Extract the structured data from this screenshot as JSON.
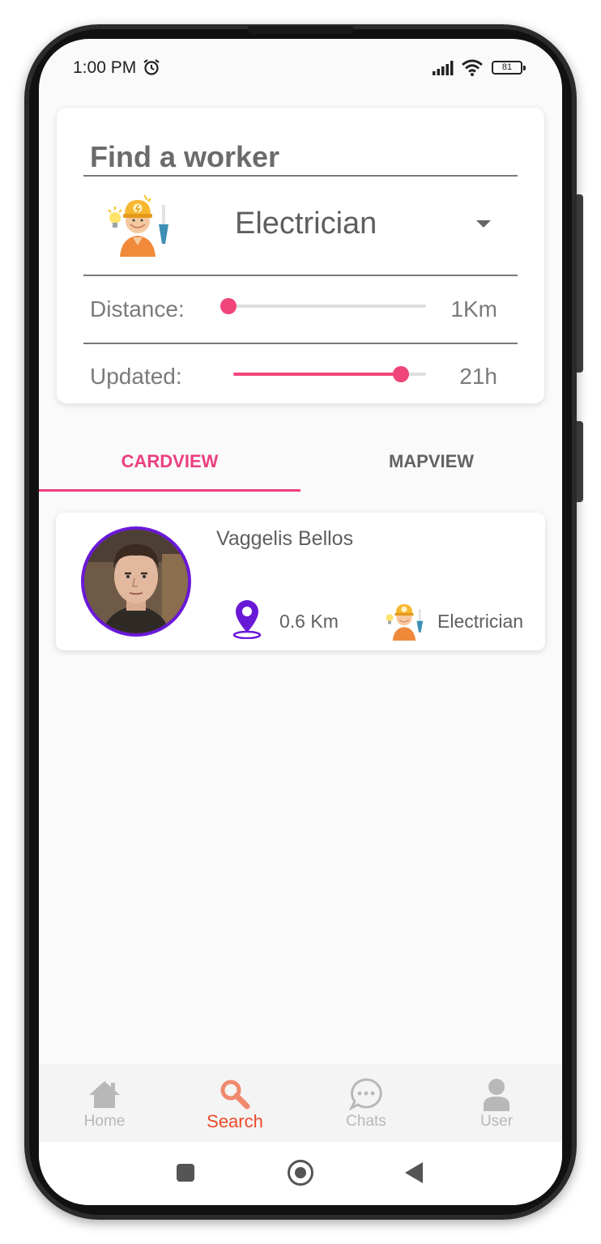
{
  "status_bar": {
    "time": "1:00 PM",
    "battery": "81",
    "icons": [
      "alarm-icon",
      "signal-icon",
      "wifi-icon",
      "battery-icon"
    ]
  },
  "search": {
    "title": "Find a worker",
    "category": "Electrician",
    "distance_label": "Distance:",
    "distance_value": "1Km",
    "distance_fraction": 0.0,
    "updated_label": "Updated:",
    "updated_value": "21h",
    "updated_fraction": 0.87
  },
  "tabs": [
    {
      "label": "CARDVIEW",
      "active": true
    },
    {
      "label": "MAPVIEW",
      "active": false
    }
  ],
  "workers": [
    {
      "name": "Vaggelis Bellos",
      "distance": "0.6 Km",
      "profession": "Electrician"
    }
  ],
  "bottom_nav": [
    {
      "label": "Home",
      "icon": "home-icon",
      "active": false
    },
    {
      "label": "Search",
      "icon": "search-icon",
      "active": true
    },
    {
      "label": "Chats",
      "icon": "chat-icon",
      "active": false
    },
    {
      "label": "User",
      "icon": "user-icon",
      "active": false
    }
  ],
  "colors": {
    "accent": "#ec3f80",
    "slider": "#f0457a",
    "profile_ring": "#6a18d8",
    "active_nav": "#ee4a2a",
    "inactive_nav": "#b8b8b8"
  }
}
